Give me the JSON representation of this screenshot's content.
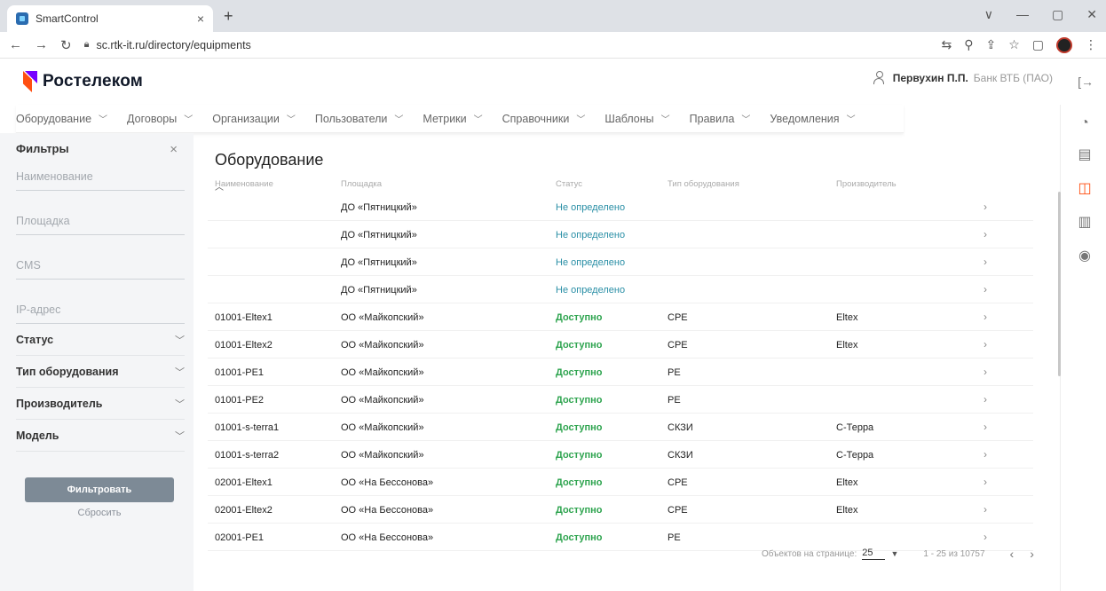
{
  "browser": {
    "tab_title": "SmartControl",
    "tab_close": "×",
    "new_tab": "+",
    "url": "sc.rtk-it.ru/directory/equipments",
    "window_controls": [
      "∨",
      "—",
      "▢",
      "✕"
    ]
  },
  "header": {
    "brand": "Ростелеком",
    "user_name": "Первухин П.П.",
    "user_org": "Банк ВТБ (ПАО)"
  },
  "topnav": [
    {
      "label": "Оборудование"
    },
    {
      "label": "Договоры"
    },
    {
      "label": "Организации"
    },
    {
      "label": "Пользователи"
    },
    {
      "label": "Метрики"
    },
    {
      "label": "Справочники"
    },
    {
      "label": "Шаблоны"
    },
    {
      "label": "Правила"
    },
    {
      "label": "Уведомления"
    }
  ],
  "sidebar": {
    "title": "Фильтры",
    "close": "×",
    "fields": [
      "Наименование",
      "Площадка",
      "CMS",
      "IP-адрес"
    ],
    "accordions": [
      "Статус",
      "Тип оборудования",
      "Производитель",
      "Модель"
    ],
    "filter_button": "Фильтровать",
    "reset_button": "Сбросить"
  },
  "main": {
    "title": "Оборудование",
    "columns": {
      "name": "Наименование",
      "site": "Площадка",
      "status": "Статус",
      "type": "Тип оборудования",
      "vendor": "Производитель"
    },
    "rows": [
      {
        "name": "",
        "site": "ДО «Пятницкий»",
        "status": "Не определено",
        "status_kind": "none",
        "type": "",
        "vendor": ""
      },
      {
        "name": "",
        "site": "ДО «Пятницкий»",
        "status": "Не определено",
        "status_kind": "none",
        "type": "",
        "vendor": ""
      },
      {
        "name": "",
        "site": "ДО «Пятницкий»",
        "status": "Не определено",
        "status_kind": "none",
        "type": "",
        "vendor": ""
      },
      {
        "name": "",
        "site": "ДО «Пятницкий»",
        "status": "Не определено",
        "status_kind": "none",
        "type": "",
        "vendor": ""
      },
      {
        "name": "01001-Eltex1",
        "site": "ОО «Майкопский»",
        "status": "Доступно",
        "status_kind": "ok",
        "type": "CPE",
        "vendor": "Eltex"
      },
      {
        "name": "01001-Eltex2",
        "site": "ОО «Майкопский»",
        "status": "Доступно",
        "status_kind": "ok",
        "type": "CPE",
        "vendor": "Eltex"
      },
      {
        "name": "01001-PE1",
        "site": "ОО «Майкопский»",
        "status": "Доступно",
        "status_kind": "ok",
        "type": "PE",
        "vendor": ""
      },
      {
        "name": "01001-PE2",
        "site": "ОО «Майкопский»",
        "status": "Доступно",
        "status_kind": "ok",
        "type": "PE",
        "vendor": ""
      },
      {
        "name": "01001-s-terra1",
        "site": "ОО «Майкопский»",
        "status": "Доступно",
        "status_kind": "ok",
        "type": "СКЗИ",
        "vendor": "С-Терра"
      },
      {
        "name": "01001-s-terra2",
        "site": "ОО «Майкопский»",
        "status": "Доступно",
        "status_kind": "ok",
        "type": "СКЗИ",
        "vendor": "С-Терра"
      },
      {
        "name": "02001-Eltex1",
        "site": "ОО «На Бессонова»",
        "status": "Доступно",
        "status_kind": "ok",
        "type": "CPE",
        "vendor": "Eltex"
      },
      {
        "name": "02001-Eltex2",
        "site": "ОО «На Бессонова»",
        "status": "Доступно",
        "status_kind": "ok",
        "type": "CPE",
        "vendor": "Eltex"
      },
      {
        "name": "02001-PE1",
        "site": "ОО «На Бессонова»",
        "status": "Доступно",
        "status_kind": "ok",
        "type": "PE",
        "vendor": ""
      }
    ],
    "pager": {
      "per_page_label": "Объектов на странице:",
      "per_page": "25",
      "range": "1 - 25 из 10757"
    }
  },
  "colors": {
    "brand_orange": "#ff4f12",
    "brand_purple": "#7700ff",
    "status_ok": "#2ea44f",
    "status_none": "#2a8fa6",
    "filter_button": "#7d8a96"
  }
}
